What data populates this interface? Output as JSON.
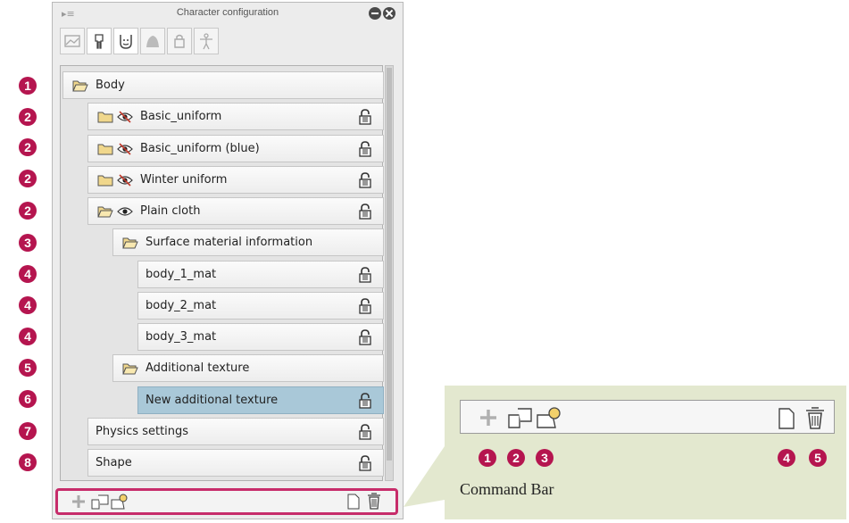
{
  "window": {
    "title": "Character configuration"
  },
  "tabs": [
    {
      "icon": "scene-icon",
      "active": false
    },
    {
      "icon": "body-icon",
      "active": true
    },
    {
      "icon": "face-icon",
      "active": true
    },
    {
      "icon": "hair-icon",
      "active": false
    },
    {
      "icon": "accessory-icon",
      "active": false
    },
    {
      "icon": "figure-icon",
      "active": false
    }
  ],
  "tree": {
    "rows": [
      {
        "label": "Body",
        "level": 0,
        "icon": "folder-open-icon",
        "lock": false
      },
      {
        "label": "Basic_uniform",
        "level": 1,
        "icon": "folder-icon",
        "visibility": "hidden",
        "lock": true
      },
      {
        "label": "Basic_uniform (blue)",
        "level": 1,
        "icon": "folder-icon",
        "visibility": "hidden",
        "lock": true
      },
      {
        "label": "Winter uniform",
        "level": 1,
        "icon": "folder-icon",
        "visibility": "hidden",
        "lock": true
      },
      {
        "label": "Plain cloth",
        "level": 1,
        "icon": "folder-open-icon",
        "visibility": "visible",
        "lock": true
      },
      {
        "label": "Surface material information",
        "level": 2,
        "icon": "folder-open-icon",
        "lock": false
      },
      {
        "label": "body_1_mat",
        "level": 3,
        "lock": true
      },
      {
        "label": "body_2_mat",
        "level": 3,
        "lock": true
      },
      {
        "label": "body_3_mat",
        "level": 3,
        "lock": true
      },
      {
        "label": "Additional texture",
        "level": 2,
        "icon": "folder-open-icon",
        "lock": false
      },
      {
        "label": "New additional texture",
        "level": 3,
        "selected": true,
        "lock": true
      },
      {
        "label": "Physics settings",
        "level": 1,
        "lock": true
      },
      {
        "label": "Shape",
        "level": 1,
        "lock": true
      }
    ]
  },
  "badges": [
    "1",
    "2",
    "2",
    "2",
    "2",
    "3",
    "4",
    "4",
    "4",
    "5",
    "6",
    "7",
    "8"
  ],
  "command_bar": {
    "caption": "Command Bar",
    "buttons": [
      "add-icon",
      "new-folder-icon",
      "material-folder-icon",
      "duplicate-icon",
      "trash-icon"
    ],
    "badges": [
      "1",
      "2",
      "3",
      "4",
      "5"
    ]
  },
  "colors": {
    "accent": "#b5154f",
    "highlight_border": "#c72c6a",
    "callout_bg": "#e3e8cf",
    "selected_row": "#a9c8d8"
  }
}
